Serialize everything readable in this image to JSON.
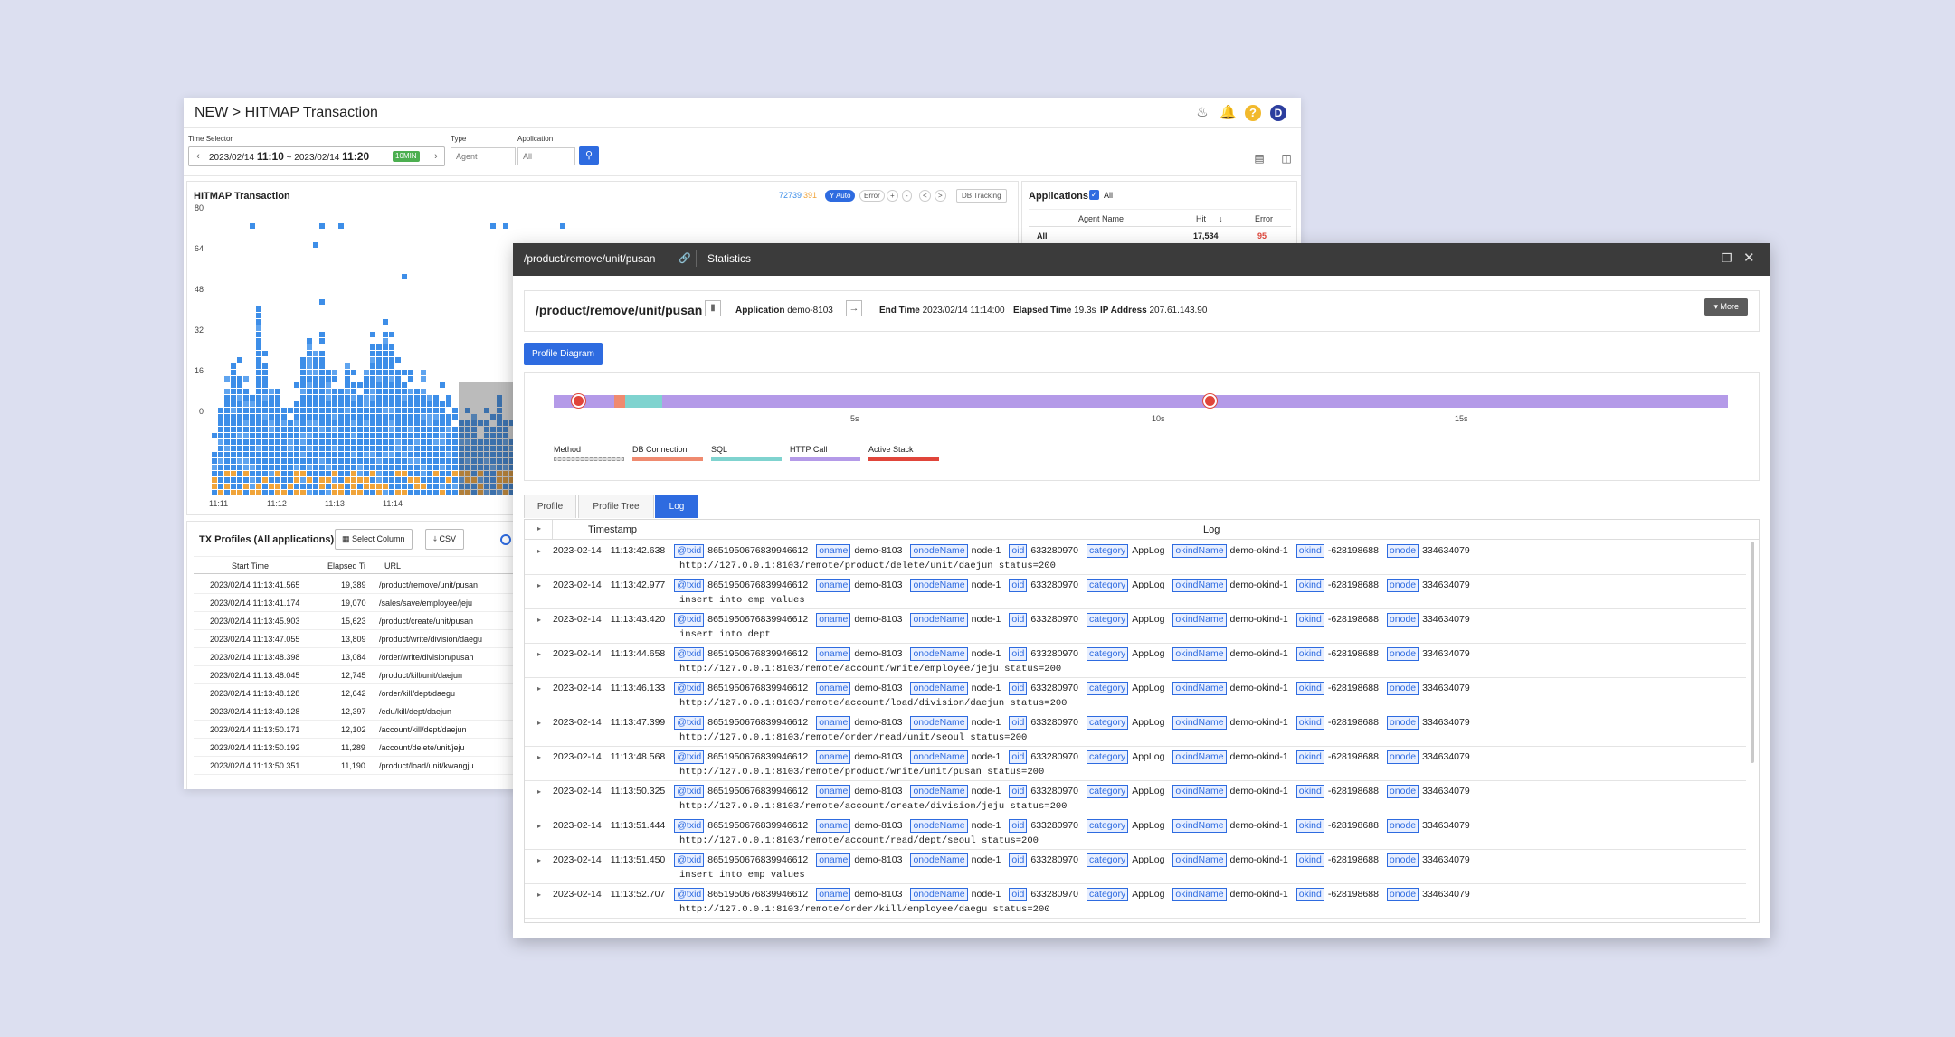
{
  "main": {
    "title": "NEW > HITMAP Transaction",
    "time_selector_label": "Time Selector",
    "time_range_date_start": "2023/02/14",
    "time_range_time_start": "11:10",
    "time_range_sep": "~",
    "time_range_date_end": "2023/02/14",
    "time_range_time_end": "11:20",
    "time_badge": "10MIN",
    "type_label": "Type",
    "type_value": "Agent",
    "application_label": "Application",
    "application_value": "All"
  },
  "hitmap": {
    "title": "HITMAP Transaction",
    "count_blue": "72739",
    "count_orange": "391",
    "yauto": "Y Auto",
    "error_btn": "Error",
    "db_tracking": "DB Tracking",
    "y_ticks": [
      "80",
      "64",
      "48",
      "32",
      "16",
      "0"
    ],
    "x_ticks": [
      "11:11",
      "11:12",
      "11:13",
      "11:14"
    ]
  },
  "applications": {
    "title": "Applications",
    "all_label": "All",
    "columns": [
      "Agent Name",
      "Hit",
      "Error"
    ],
    "rows": [
      {
        "name": "All",
        "hit": "17,534",
        "error": "95"
      }
    ]
  },
  "tx_profiles": {
    "title": "TX Profiles (All applications)",
    "select_column": "Select Column",
    "csv": "CSV",
    "columns": [
      "Start Time",
      "Elapsed Ti",
      "URL"
    ],
    "rows": [
      {
        "start": "2023/02/14 11:13:41.565",
        "elapsed": "19,389",
        "url": "/product/remove/unit/pusan"
      },
      {
        "start": "2023/02/14 11:13:41.174",
        "elapsed": "19,070",
        "url": "/sales/save/employee/jeju"
      },
      {
        "start": "2023/02/14 11:13:45.903",
        "elapsed": "15,623",
        "url": "/product/create/unit/pusan"
      },
      {
        "start": "2023/02/14 11:13:47.055",
        "elapsed": "13,809",
        "url": "/product/write/division/daegu"
      },
      {
        "start": "2023/02/14 11:13:48.398",
        "elapsed": "13,084",
        "url": "/order/write/division/pusan"
      },
      {
        "start": "2023/02/14 11:13:48.045",
        "elapsed": "12,745",
        "url": "/product/kill/unit/daejun"
      },
      {
        "start": "2023/02/14 11:13:48.128",
        "elapsed": "12,642",
        "url": "/order/kill/dept/daegu"
      },
      {
        "start": "2023/02/14 11:13:49.128",
        "elapsed": "12,397",
        "url": "/edu/kill/dept/daejun"
      },
      {
        "start": "2023/02/14 11:13:50.171",
        "elapsed": "12,102",
        "url": "/account/kill/dept/daejun"
      },
      {
        "start": "2023/02/14 11:13:50.192",
        "elapsed": "11,289",
        "url": "/account/delete/unit/jeju"
      },
      {
        "start": "2023/02/14 11:13:50.351",
        "elapsed": "11,190",
        "url": "/product/load/unit/kwangju"
      }
    ]
  },
  "profile": {
    "header_path": "/product/remove/unit/pusan",
    "header_stat": "Statistics",
    "path": "/product/remove/unit/pusan",
    "application_label": "Application",
    "application_value": "demo-8103",
    "end_time_label": "End Time",
    "end_time_value": "2023/02/14 11:14:00",
    "elapsed_label": "Elapsed Time",
    "elapsed_value": "19.3s",
    "ip_label": "IP Address",
    "ip_value": "207.61.143.90",
    "more": "More",
    "profile_diagram": "Profile Diagram",
    "timeline_ticks": [
      "5s",
      "10s",
      "15s"
    ],
    "legend": [
      {
        "label": "Method",
        "color": "#dddddd"
      },
      {
        "label": "DB Connection",
        "color": "#ef8a6f"
      },
      {
        "label": "SQL",
        "color": "#7fd3cf"
      },
      {
        "label": "HTTP Call",
        "color": "#b49ae8"
      },
      {
        "label": "Active Stack",
        "color": "#e0453a"
      }
    ],
    "tabs": [
      "Profile",
      "Profile Tree",
      "Log"
    ],
    "log_columns": [
      "Timestamp",
      "Log"
    ],
    "log_rows": [
      {
        "date": "2023-02-14",
        "time": "11:13:42.638",
        "txid": "8651950676839946612",
        "oname": "demo-8103",
        "onodeName": "node-1",
        "oid": "633280970",
        "category": "AppLog",
        "okindName": "demo-okind-1",
        "okind": "-628198688",
        "onode": "334634079",
        "msg": "http://127.0.0.1:8103/remote/product/delete/unit/daejun status=200"
      },
      {
        "date": "2023-02-14",
        "time": "11:13:42.977",
        "txid": "8651950676839946612",
        "oname": "demo-8103",
        "onodeName": "node-1",
        "oid": "633280970",
        "category": "AppLog",
        "okindName": "demo-okind-1",
        "okind": "-628198688",
        "onode": "334634079",
        "msg": "insert into emp values"
      },
      {
        "date": "2023-02-14",
        "time": "11:13:43.420",
        "txid": "8651950676839946612",
        "oname": "demo-8103",
        "onodeName": "node-1",
        "oid": "633280970",
        "category": "AppLog",
        "okindName": "demo-okind-1",
        "okind": "-628198688",
        "onode": "334634079",
        "msg": "insert into dept"
      },
      {
        "date": "2023-02-14",
        "time": "11:13:44.658",
        "txid": "8651950676839946612",
        "oname": "demo-8103",
        "onodeName": "node-1",
        "oid": "633280970",
        "category": "AppLog",
        "okindName": "demo-okind-1",
        "okind": "-628198688",
        "onode": "334634079",
        "msg": "http://127.0.0.1:8103/remote/account/write/employee/jeju status=200"
      },
      {
        "date": "2023-02-14",
        "time": "11:13:46.133",
        "txid": "8651950676839946612",
        "oname": "demo-8103",
        "onodeName": "node-1",
        "oid": "633280970",
        "category": "AppLog",
        "okindName": "demo-okind-1",
        "okind": "-628198688",
        "onode": "334634079",
        "msg": "http://127.0.0.1:8103/remote/account/load/division/daejun status=200"
      },
      {
        "date": "2023-02-14",
        "time": "11:13:47.399",
        "txid": "8651950676839946612",
        "oname": "demo-8103",
        "onodeName": "node-1",
        "oid": "633280970",
        "category": "AppLog",
        "okindName": "demo-okind-1",
        "okind": "-628198688",
        "onode": "334634079",
        "msg": "http://127.0.0.1:8103/remote/order/read/unit/seoul status=200"
      },
      {
        "date": "2023-02-14",
        "time": "11:13:48.568",
        "txid": "8651950676839946612",
        "oname": "demo-8103",
        "onodeName": "node-1",
        "oid": "633280970",
        "category": "AppLog",
        "okindName": "demo-okind-1",
        "okind": "-628198688",
        "onode": "334634079",
        "msg": "http://127.0.0.1:8103/remote/product/write/unit/pusan status=200"
      },
      {
        "date": "2023-02-14",
        "time": "11:13:50.325",
        "txid": "8651950676839946612",
        "oname": "demo-8103",
        "onodeName": "node-1",
        "oid": "633280970",
        "category": "AppLog",
        "okindName": "demo-okind-1",
        "okind": "-628198688",
        "onode": "334634079",
        "msg": "http://127.0.0.1:8103/remote/account/create/division/jeju status=200"
      },
      {
        "date": "2023-02-14",
        "time": "11:13:51.444",
        "txid": "8651950676839946612",
        "oname": "demo-8103",
        "onodeName": "node-1",
        "oid": "633280970",
        "category": "AppLog",
        "okindName": "demo-okind-1",
        "okind": "-628198688",
        "onode": "334634079",
        "msg": "http://127.0.0.1:8103/remote/account/read/dept/seoul status=200"
      },
      {
        "date": "2023-02-14",
        "time": "11:13:51.450",
        "txid": "8651950676839946612",
        "oname": "demo-8103",
        "onodeName": "node-1",
        "oid": "633280970",
        "category": "AppLog",
        "okindName": "demo-okind-1",
        "okind": "-628198688",
        "onode": "334634079",
        "msg": "insert into emp values"
      },
      {
        "date": "2023-02-14",
        "time": "11:13:52.707",
        "txid": "8651950676839946612",
        "oname": "demo-8103",
        "onodeName": "node-1",
        "oid": "633280970",
        "category": "AppLog",
        "okindName": "demo-okind-1",
        "okind": "-628198688",
        "onode": "334634079",
        "msg": "http://127.0.0.1:8103/remote/order/kill/employee/daegu status=200"
      }
    ],
    "tag_labels": {
      "txid": "@txid",
      "oname": "oname",
      "onodeName": "onodeName",
      "oid": "oid",
      "category": "category",
      "okindName": "okindName",
      "okind": "okind",
      "onode": "onode"
    }
  },
  "colors": {
    "accent": "#2e6be0",
    "cell_blue": "#3d8ee8",
    "cell_orange": "#f0a43a",
    "error_red": "#e0453a"
  }
}
